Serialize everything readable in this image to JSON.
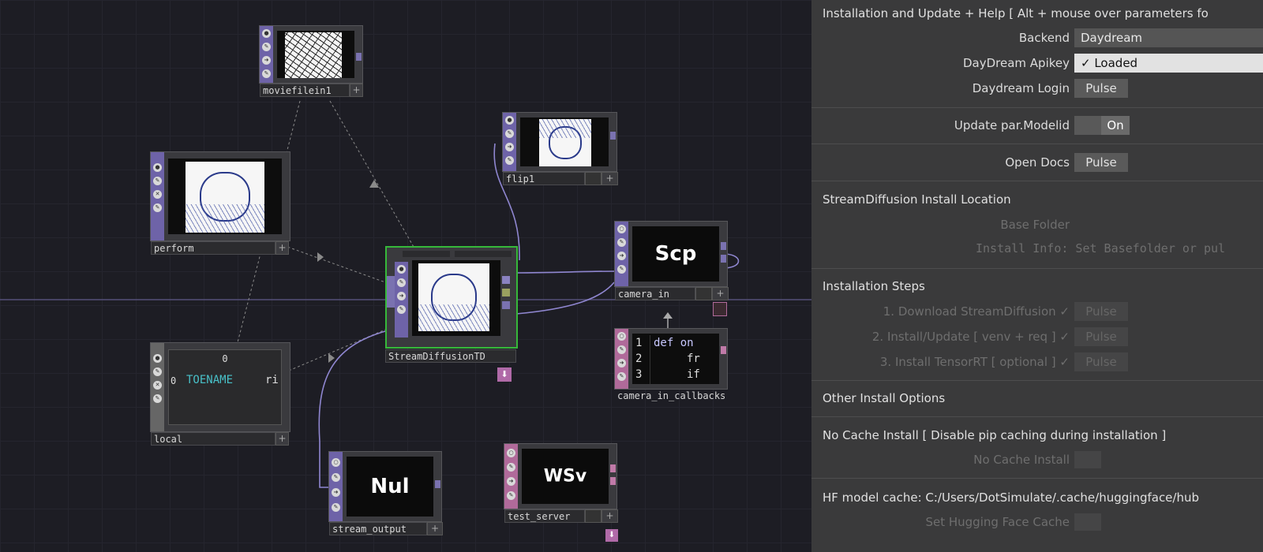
{
  "nodes": {
    "moviefilein": {
      "label": "moviefilein1"
    },
    "perform": {
      "label": "perform"
    },
    "local": {
      "label": "local",
      "cell_header": "0",
      "cell_index": "0",
      "cell_value": "TOENAME",
      "cell_extra": "ri"
    },
    "flip": {
      "label": "flip1"
    },
    "streamdiffusion": {
      "label": "StreamDiffusionTD"
    },
    "camera_in": {
      "label": "camera_in",
      "op_text": "Scp"
    },
    "camera_in_callbacks": {
      "label": "camera_in_callbacks",
      "lines": [
        "1",
        "2",
        "3"
      ],
      "code": [
        "def on",
        "fr",
        "if"
      ]
    },
    "stream_output": {
      "label": "stream_output",
      "op_text": "Nul"
    },
    "test_server": {
      "label": "test_server",
      "op_text": "WSv"
    },
    "plus": "+"
  },
  "params": {
    "header": "Installation and Update + Help [ Alt + mouse over parameters fo",
    "backend": {
      "label": "Backend",
      "value": "Daydream"
    },
    "apikey": {
      "label": "DayDream Apikey",
      "value": "✓  Loaded"
    },
    "login": {
      "label": "Daydream Login",
      "button": "Pulse"
    },
    "update_modelid": {
      "label": "Update par.Modelid",
      "value": "On"
    },
    "open_docs": {
      "label": "Open Docs",
      "button": "Pulse"
    },
    "install_location": {
      "title": "StreamDiffusion Install Location",
      "base_folder": "Base Folder",
      "install_info": "Install Info:  Set Basefolder or pul"
    },
    "install_steps": {
      "title": "Installation Steps",
      "steps": [
        {
          "label": "1. Download StreamDiffusion ✓",
          "button": "Pulse"
        },
        {
          "label": "2. Install/Update [ venv + req ] ✓",
          "button": "Pulse"
        },
        {
          "label": "3. Install TensorRT [ optional ] ✓",
          "button": "Pulse"
        }
      ]
    },
    "other_options": {
      "title": "Other Install Options"
    },
    "no_cache": {
      "title": "No Cache Install [ Disable pip caching during installation ]",
      "label": "No Cache Install"
    },
    "hf_cache": {
      "title": "HF model cache: C:/Users/DotSimulate/.cache/huggingface/hub",
      "label": "Set Hugging Face Cache"
    }
  }
}
